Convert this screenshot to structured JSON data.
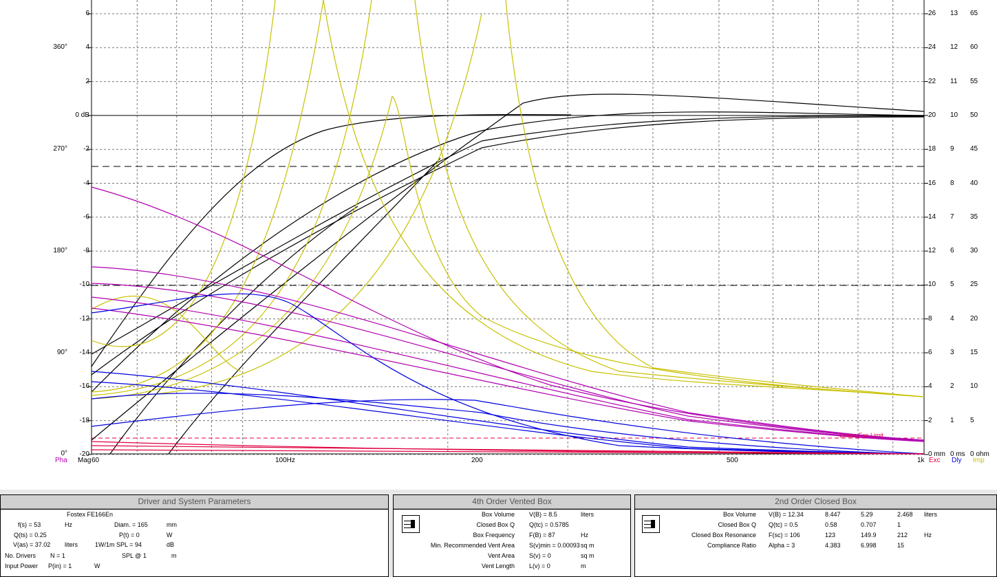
{
  "app": {
    "name": "Speaker design graph"
  },
  "graph": {
    "y_mag_ticks": [
      "6",
      "4",
      "2",
      "0 dB",
      "-2",
      "-4",
      "-6",
      "-8",
      "-10",
      "-12",
      "-14",
      "-16",
      "-18",
      "-20"
    ],
    "phase_ticks": [
      "360°",
      "270°",
      "180°",
      "90°",
      "0°"
    ],
    "right_col1": [
      "26",
      "24",
      "22",
      "20",
      "18",
      "16",
      "14",
      "12",
      "10",
      "8",
      "6",
      "4",
      "2",
      "0 mm"
    ],
    "right_col2": [
      "13",
      "12",
      "11",
      "10",
      "9",
      "8",
      "7",
      "6",
      "5",
      "4",
      "3",
      "2",
      "1",
      "0 ms"
    ],
    "right_col3": [
      "65",
      "60",
      "55",
      "50",
      "45",
      "40",
      "35",
      "30",
      "25",
      "20",
      "15",
      "10",
      "5",
      "0 ohm"
    ],
    "x_labels": [
      "Pha",
      "Mag",
      "60",
      "100Hz",
      "200",
      "500",
      "1k",
      "Exc",
      "Dly",
      "Imp"
    ],
    "linear_exc_label": "Linear Exc Limit",
    "colors": {
      "mag": "#000000",
      "phase": "#b000b0",
      "delay": "#0000e0",
      "imp": "#c8c000",
      "exc": "#e00040"
    }
  },
  "driver_panel": {
    "title": "Driver and System Parameters",
    "model": "Fostex FE166En",
    "fs_label": "f(s) = 53",
    "fs_unit": "Hz",
    "diam_label": "Diam. = 165",
    "diam_unit": "mm",
    "qts_label": "Q(ts) = 0.25",
    "pt_label": "P(t) = 0",
    "pt_unit": "W",
    "vas_label": "V(as) = 37.02",
    "vas_unit": "liters",
    "spl_label": "1W/1m SPL = 94",
    "spl_unit": "dB",
    "nd_label": "No. Drivers",
    "nd_value": "N = 1",
    "splat_label": "SPL @ 1",
    "splat_unit": "m",
    "ip_label": "Input Power",
    "ip_value": "P(in) = 1",
    "ip_unit": "W"
  },
  "vented_panel": {
    "title": "4th Order Vented Box",
    "rows": [
      {
        "label": "Box Volume",
        "value": "V(B) = 8.5",
        "unit": "liters"
      },
      {
        "label": "Closed Box Q",
        "value": "Q(tc) = 0.5785",
        "unit": ""
      },
      {
        "label": "Box Frequency",
        "value": "F(B) = 87",
        "unit": "Hz"
      },
      {
        "label": "Min. Recommended Vent Area",
        "value": "S(v)min = 0.00093",
        "unit": "sq m"
      },
      {
        "label": "Vent Area",
        "value": "S(v) = 0",
        "unit": "sq m"
      },
      {
        "label": "Vent Length",
        "value": "L(v) = 0",
        "unit": "m"
      }
    ]
  },
  "closed_panel": {
    "title": "2nd Order Closed Box",
    "rows": [
      {
        "label": "Box Volume",
        "v1": "V(B) = 12.34",
        "v2": "8.447",
        "v3": "5.29",
        "v4": "2.468",
        "unit": "liters"
      },
      {
        "label": "Closed Box Q",
        "v1": "Q(tc) = 0.5",
        "v2": "0.58",
        "v3": "0.707",
        "v4": "1",
        "unit": ""
      },
      {
        "label": "Closed Box Resonance",
        "v1": "F(sc) = 106",
        "v2": "123",
        "v3": "149.9",
        "v4": "212",
        "unit": "Hz"
      },
      {
        "label": "Compliance Ratio",
        "v1": "Alpha = 3",
        "v2": "4.383",
        "v3": "6.998",
        "v4": "15",
        "unit": ""
      }
    ]
  }
}
